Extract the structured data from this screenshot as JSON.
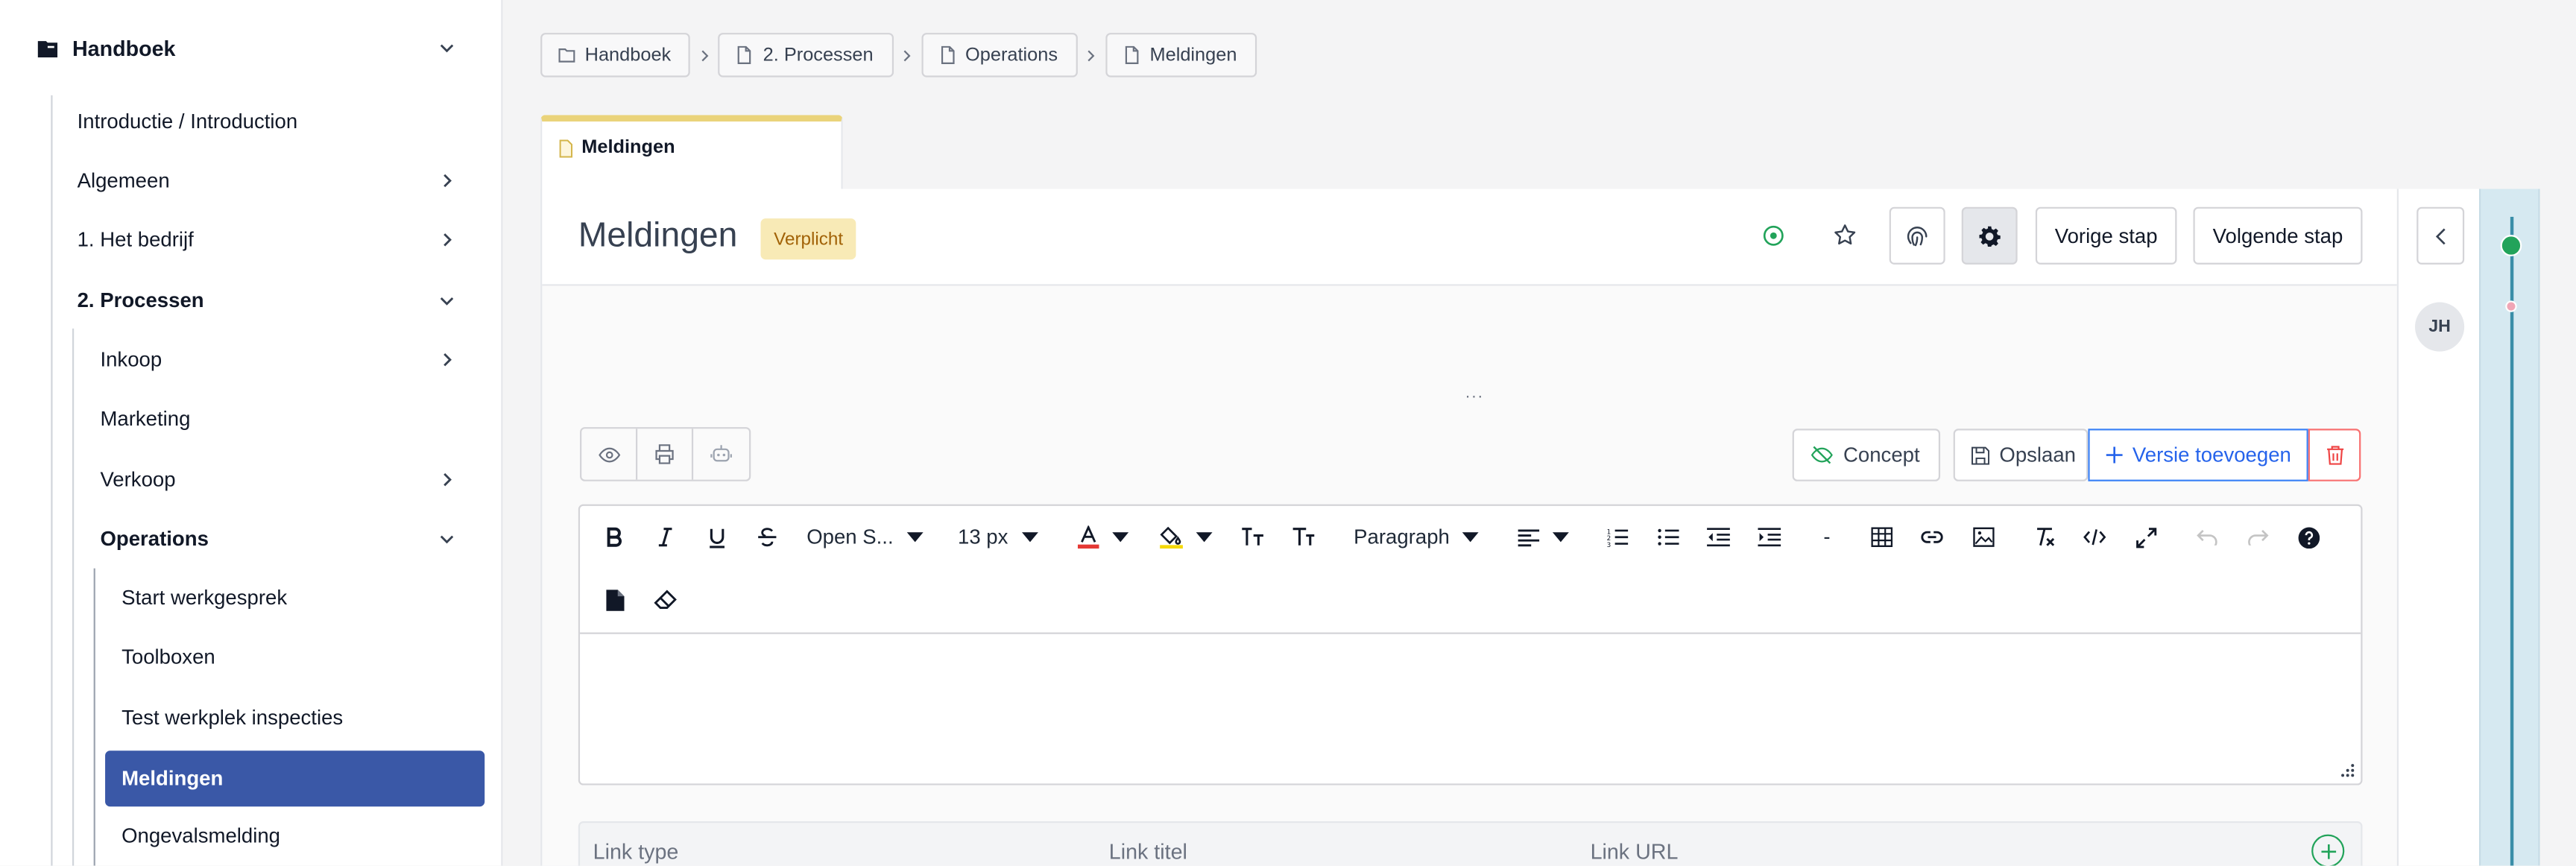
{
  "sidebar": {
    "header": "Handboek",
    "items": [
      {
        "label": "Introductie / Introduction"
      },
      {
        "label": "Algemeen"
      },
      {
        "label": "1. Het bedrijf"
      },
      {
        "label": "2. Processen"
      },
      {
        "label": "Inkoop"
      },
      {
        "label": "Marketing"
      },
      {
        "label": "Verkoop"
      },
      {
        "label": "Operations"
      },
      {
        "label": "Start werkgesprek"
      },
      {
        "label": "Toolboxen"
      },
      {
        "label": "Test werkplek inspecties"
      },
      {
        "label": "Meldingen"
      },
      {
        "label": "Ongevalsmelding"
      }
    ]
  },
  "breadcrumb": [
    {
      "label": "Handboek",
      "icon": "folder-icon"
    },
    {
      "label": "2. Processen",
      "icon": "document-icon"
    },
    {
      "label": "Operations",
      "icon": "document-icon"
    },
    {
      "label": "Meldingen",
      "icon": "document-icon"
    }
  ],
  "tab": {
    "label": "Meldingen"
  },
  "page": {
    "title": "Meldingen",
    "badge": "Verplicht",
    "prev_label": "Vorige stap",
    "next_label": "Volgende stap",
    "ellipsis": "..."
  },
  "actions": {
    "concept": "Concept",
    "save": "Opslaan",
    "add_version": "Versie toevoegen"
  },
  "editor": {
    "font_family": "Open S...",
    "font_size": "13 px",
    "block_format": "Paragraph",
    "hr_label": "-"
  },
  "links_table": {
    "columns": [
      "Link type",
      "Link titel",
      "Link URL"
    ]
  },
  "rail": {
    "avatar_initials": "JH"
  },
  "colors": {
    "active_item": "#3a58a7",
    "badge_bg": "#f8eab6",
    "badge_text": "#a16207",
    "tab_accent": "#ead37a",
    "primary_blue": "#2563eb",
    "danger": "#ef4444",
    "success": "#22a35a",
    "timeline_bg": "#d6e9f1"
  }
}
